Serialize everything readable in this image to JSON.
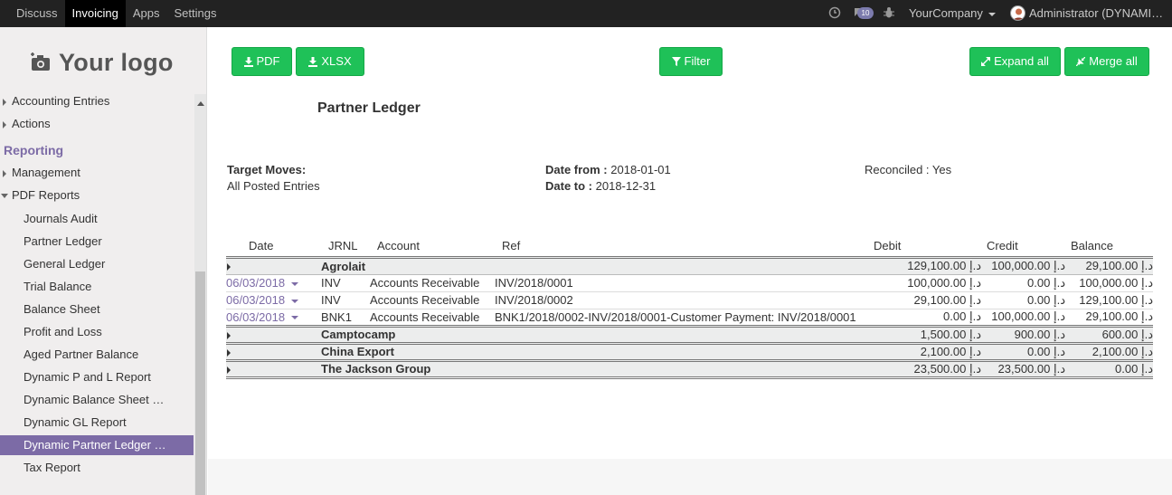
{
  "topbar": {
    "menu": [
      "Discuss",
      "Invoicing",
      "Apps",
      "Settings"
    ],
    "active_menu": "Invoicing",
    "messages_badge": "10",
    "company": "YourCompany",
    "user": "Administrator (DYNAMIC PARTNER LEDGER)"
  },
  "sidebar": {
    "logo_text": "Your logo",
    "top_items": [
      "Accounting Entries",
      "Actions"
    ],
    "section": "Reporting",
    "section_items": [
      "Management",
      "PDF Reports"
    ],
    "sub_items": [
      "Journals Audit",
      "Partner Ledger",
      "General Ledger",
      "Trial Balance",
      "Balance Sheet",
      "Profit and Loss",
      "Aged Partner Balance",
      "Dynamic P and L Report",
      "Dynamic Balance Sheet Report",
      "Dynamic GL Report",
      "Dynamic Partner Ledger Report",
      "Tax Report"
    ],
    "active_item": "Dynamic Partner Ledger Report"
  },
  "toolbar": {
    "pdf": "PDF",
    "xlsx": "XLSX",
    "filter": "Filter",
    "expand_all": "Expand all",
    "merge_all": "Merge all"
  },
  "report": {
    "title": "Partner Ledger",
    "target_moves_label": "Target Moves:",
    "target_moves_value": "All Posted Entries",
    "date_from_label": "Date from :",
    "date_from_value": "2018-01-01",
    "date_to_label": "Date to :",
    "date_to_value": "2018-12-31",
    "reconciled": "Reconciled : Yes"
  },
  "table": {
    "headers": [
      "Date",
      "JRNL",
      "Account",
      "Ref",
      "Debit",
      "Credit",
      "Balance"
    ],
    "currency": "د.إ",
    "partners": [
      {
        "name": "Agrolait",
        "debit": "129,100.00",
        "credit": "100,000.00",
        "balance": "29,100.00",
        "lines": [
          {
            "date": "06/03/2018",
            "jrnl": "INV",
            "account": "Accounts Receivable",
            "ref": "INV/2018/0001",
            "debit": "100,000.00",
            "credit": "0.00",
            "balance": "100,000.00"
          },
          {
            "date": "06/03/2018",
            "jrnl": "INV",
            "account": "Accounts Receivable",
            "ref": "INV/2018/0002",
            "debit": "29,100.00",
            "credit": "0.00",
            "balance": "129,100.00"
          },
          {
            "date": "06/03/2018",
            "jrnl": "BNK1",
            "account": "Accounts Receivable",
            "ref": "BNK1/2018/0002-INV/2018/0001-Customer Payment: INV/2018/0001",
            "debit": "0.00",
            "credit": "100,000.00",
            "balance": "29,100.00"
          }
        ]
      },
      {
        "name": "Camptocamp",
        "debit": "1,500.00",
        "credit": "900.00",
        "balance": "600.00",
        "lines": []
      },
      {
        "name": "China Export",
        "debit": "2,100.00",
        "credit": "0.00",
        "balance": "2,100.00",
        "lines": []
      },
      {
        "name": "The Jackson Group",
        "debit": "23,500.00",
        "credit": "23,500.00",
        "balance": "0.00",
        "lines": []
      }
    ]
  }
}
